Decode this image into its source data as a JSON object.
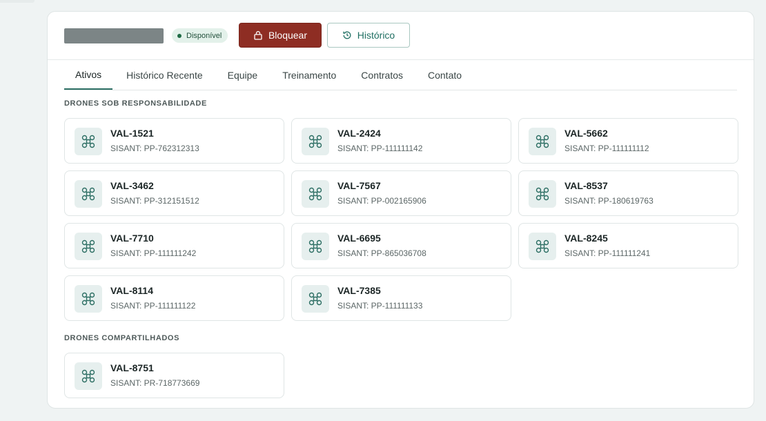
{
  "header": {
    "status_label": "Disponível",
    "block_button": "Bloquear",
    "history_button": "Histórico"
  },
  "tabs": [
    "Ativos",
    "Histórico Recente",
    "Equipe",
    "Treinamento",
    "Contratos",
    "Contato"
  ],
  "active_tab": "Ativos",
  "sections": {
    "owned_title": "DRONES SOB RESPONSABILIDADE",
    "shared_title": "DRONES COMPARTILHADOS"
  },
  "owned_drones": [
    {
      "name": "VAL-1521",
      "sisant": "SISANT: PP-762312313"
    },
    {
      "name": "VAL-2424",
      "sisant": "SISANT: PP-111111142"
    },
    {
      "name": "VAL-5662",
      "sisant": "SISANT: PP-111111112"
    },
    {
      "name": "VAL-3462",
      "sisant": "SISANT: PP-312151512"
    },
    {
      "name": "VAL-7567",
      "sisant": "SISANT: PP-002165906"
    },
    {
      "name": "VAL-8537",
      "sisant": "SISANT: PP-180619763"
    },
    {
      "name": "VAL-7710",
      "sisant": "SISANT: PP-111111242"
    },
    {
      "name": "VAL-6695",
      "sisant": "SISANT: PP-865036708"
    },
    {
      "name": "VAL-8245",
      "sisant": "SISANT: PP-111111241"
    },
    {
      "name": "VAL-8114",
      "sisant": "SISANT: PP-111111122"
    },
    {
      "name": "VAL-7385",
      "sisant": "SISANT: PP-111111133"
    }
  ],
  "shared_drones": [
    {
      "name": "VAL-8751",
      "sisant": "SISANT: PR-718773669"
    }
  ],
  "icons": {
    "drone": "drone-icon",
    "lock": "lock-icon",
    "history": "history-icon"
  },
  "colors": {
    "accent": "#2c6e63",
    "danger": "#8e2d23",
    "status_bg": "#e3f1ea",
    "status_dot": "#1f6b45"
  }
}
